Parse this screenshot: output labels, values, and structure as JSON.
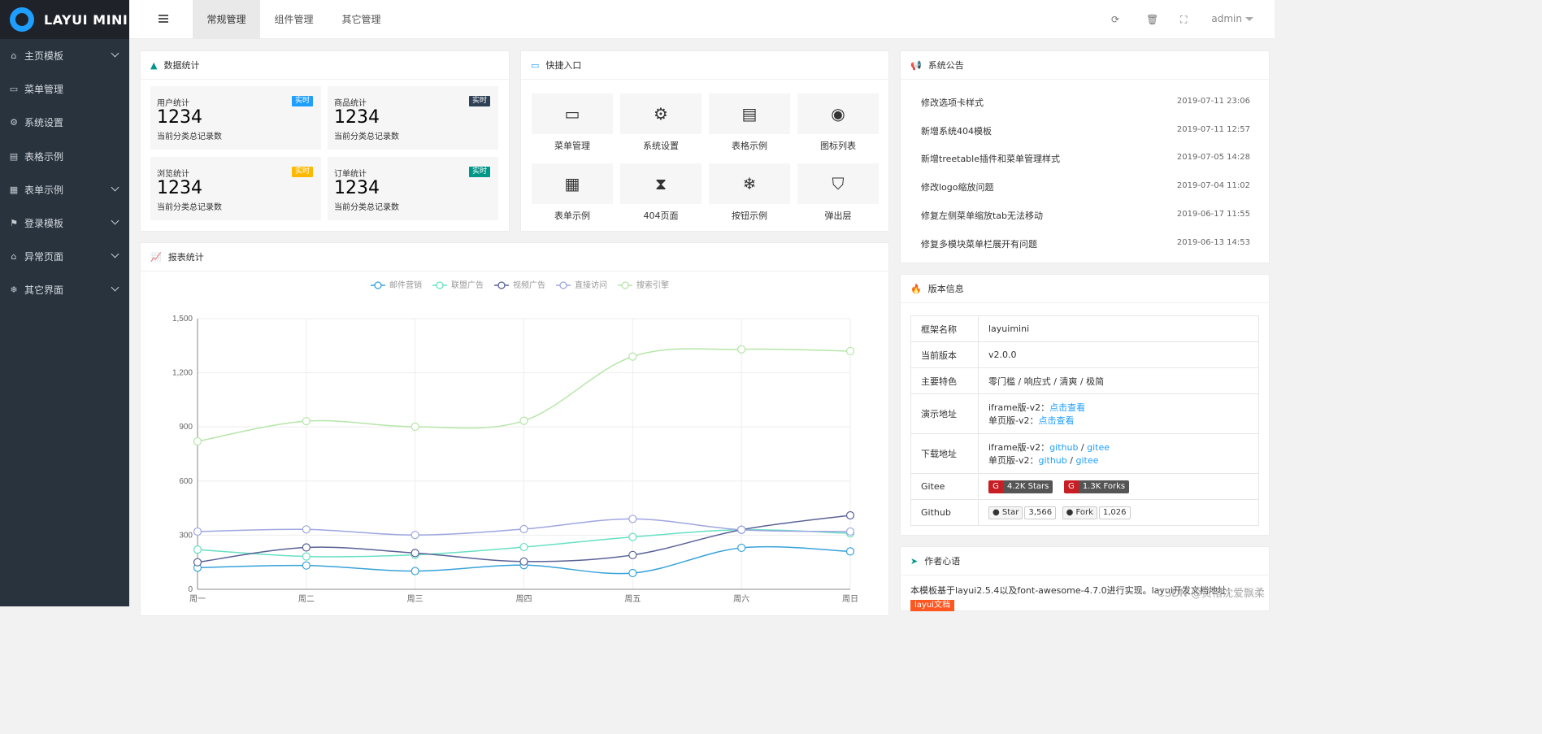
{
  "app": {
    "logo_text": "LAYUI MINI"
  },
  "sidebar": {
    "items": [
      {
        "label": "主页模板",
        "icon": "home-icon",
        "glyph": "⌂",
        "expand": true
      },
      {
        "label": "菜单管理",
        "icon": "window-icon",
        "glyph": "▭",
        "expand": false
      },
      {
        "label": "系统设置",
        "icon": "gears-icon",
        "glyph": "⚙",
        "expand": false
      },
      {
        "label": "表格示例",
        "icon": "file-icon",
        "glyph": "▤",
        "expand": false
      },
      {
        "label": "表单示例",
        "icon": "calendar-icon",
        "glyph": "▦",
        "expand": true
      },
      {
        "label": "登录模板",
        "icon": "flag-icon",
        "glyph": "⚑",
        "expand": true
      },
      {
        "label": "异常页面",
        "icon": "home-icon",
        "glyph": "⌂",
        "expand": true
      },
      {
        "label": "其它界面",
        "icon": "snowflake-icon",
        "glyph": "❄",
        "expand": true
      }
    ]
  },
  "header": {
    "tabs": [
      "常规管理",
      "组件管理",
      "其它管理"
    ],
    "active_tab": 0,
    "user": "admin"
  },
  "stats": {
    "title": "数据统计",
    "boxes": [
      {
        "label": "用户统计",
        "value": "1234",
        "sub": "当前分类总记录数",
        "badge": "实时",
        "badge_color": "#1e9fff"
      },
      {
        "label": "商品统计",
        "value": "1234",
        "sub": "当前分类总记录数",
        "badge": "实时",
        "badge_color": "#2f4056"
      },
      {
        "label": "浏览统计",
        "value": "1234",
        "sub": "当前分类总记录数",
        "badge": "实时",
        "badge_color": "#ffb800"
      },
      {
        "label": "订单统计",
        "value": "1234",
        "sub": "当前分类总记录数",
        "badge": "实时",
        "badge_color": "#009688"
      }
    ]
  },
  "quick": {
    "title": "快捷入口",
    "items": [
      {
        "label": "菜单管理",
        "icon": "window-icon",
        "glyph": "▭"
      },
      {
        "label": "系统设置",
        "icon": "gears-icon",
        "glyph": "⚙"
      },
      {
        "label": "表格示例",
        "icon": "file-text-icon",
        "glyph": "▤"
      },
      {
        "label": "图标列表",
        "icon": "dot-circle-icon",
        "glyph": "◉"
      },
      {
        "label": "表单示例",
        "icon": "calendar-icon",
        "glyph": "▦"
      },
      {
        "label": "404页面",
        "icon": "hourglass-icon",
        "glyph": "⧗"
      },
      {
        "label": "按钮示例",
        "icon": "snowflake-icon",
        "glyph": "❄"
      },
      {
        "label": "弹出层",
        "icon": "shield-icon",
        "glyph": "⛉"
      }
    ]
  },
  "notices": {
    "title": "系统公告",
    "items": [
      {
        "text": "修改选项卡样式",
        "date": "2019-07-11 23:06"
      },
      {
        "text": "新增系统404模板",
        "date": "2019-07-11 12:57"
      },
      {
        "text": "新增treetable插件和菜单管理样式",
        "date": "2019-07-05 14:28"
      },
      {
        "text": "修改logo缩放问题",
        "date": "2019-07-04 11:02"
      },
      {
        "text": "修复左侧菜单缩放tab无法移动",
        "date": "2019-06-17 11:55"
      },
      {
        "text": "修复多模块菜单栏展开有问题",
        "date": "2019-06-13 14:53"
      }
    ]
  },
  "version": {
    "title": "版本信息",
    "framework_label": "框架名称",
    "framework": "layuimini",
    "current_label": "当前版本",
    "current": "v2.0.0",
    "features_label": "主要特色",
    "features": "零门槛 / 响应式 / 清爽 / 极简",
    "demo_label": "演示地址",
    "demo_iframe": "iframe版-v2：",
    "demo_single": "单页版-v2：",
    "demo_link": "点击查看",
    "download_label": "下载地址",
    "dl_iframe": "iframe版-v2：",
    "dl_single": "单页版-v2：",
    "github": "github",
    "slash": " / ",
    "gitee": "gitee",
    "gitee_label": "Gitee",
    "gitee_stars": "4.2K Stars",
    "gitee_forks": "1.3K Forks",
    "github_label": "Github",
    "gh_star": "Star",
    "gh_star_count": "3,566",
    "gh_fork": "Fork",
    "gh_fork_count": "1,026"
  },
  "author": {
    "title": "作者心语",
    "text": "本模板基于layui2.5.4以及font-awesome-4.7.0进行实现。layui开发文档地址：",
    "tag": "layui文档"
  },
  "report": {
    "title": "报表统计"
  },
  "watermark": "CSDN @资惜沈爱飘柔",
  "chart_data": {
    "type": "line",
    "categories": [
      "周一",
      "周二",
      "周三",
      "周四",
      "周五",
      "周六",
      "周日"
    ],
    "ylim": [
      0,
      1500
    ],
    "yticks": [
      "0",
      "300",
      "600",
      "900",
      "1,200",
      "1,500"
    ],
    "series": [
      {
        "name": "邮件营销",
        "color": "#37a2da",
        "values": [
          120,
          132,
          101,
          134,
          90,
          230,
          210
        ]
      },
      {
        "name": "联盟广告",
        "color": "#67e0c4",
        "values": [
          220,
          182,
          191,
          234,
          290,
          330,
          310
        ]
      },
      {
        "name": "视频广告",
        "color": "#596195",
        "values": [
          150,
          232,
          201,
          154,
          190,
          330,
          410
        ]
      },
      {
        "name": "直接访问",
        "color": "#9ea6e0",
        "values": [
          320,
          332,
          301,
          334,
          390,
          330,
          320
        ]
      },
      {
        "name": "搜索引擎",
        "color": "#b6e6a8",
        "values": [
          820,
          932,
          901,
          934,
          1290,
          1330,
          1320
        ]
      }
    ]
  }
}
